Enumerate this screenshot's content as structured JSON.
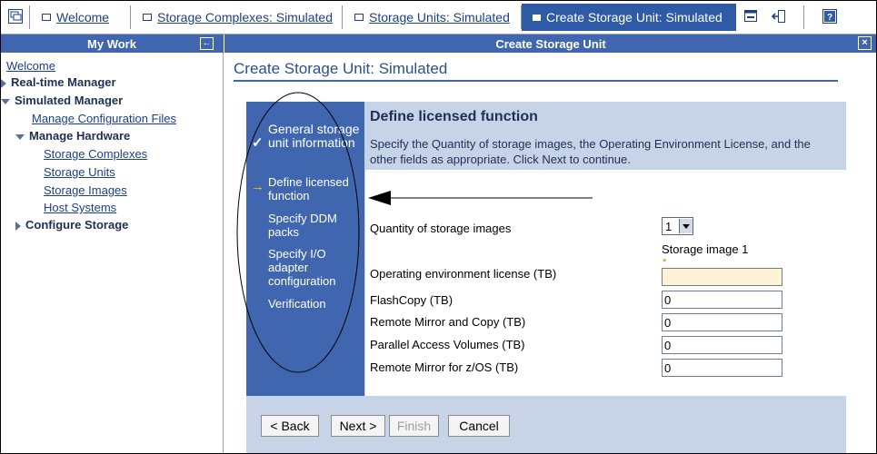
{
  "tabs": [
    {
      "label": "Welcome"
    },
    {
      "label": "Storage Complexes: Simulated"
    },
    {
      "label": "Storage Units: Simulated"
    },
    {
      "label": "Create Storage Unit: Simulated",
      "active": true
    }
  ],
  "sidebar": {
    "header": "My Work",
    "items": [
      {
        "label": "Welcome"
      },
      {
        "label": "Real-time Manager"
      },
      {
        "label": "Simulated Manager"
      },
      {
        "label": "Manage Configuration Files"
      },
      {
        "label": "Manage Hardware"
      },
      {
        "label": "Storage Complexes"
      },
      {
        "label": "Storage Units"
      },
      {
        "label": "Storage Images"
      },
      {
        "label": "Host Systems"
      },
      {
        "label": "Configure Storage"
      }
    ]
  },
  "main": {
    "header": "Create Storage Unit",
    "page_title": "Create Storage Unit: Simulated"
  },
  "wizard": {
    "steps": [
      {
        "label": "General storage unit information",
        "state": "done"
      },
      {
        "label": "Define licensed function",
        "state": "current"
      },
      {
        "label": "Specify DDM packs",
        "state": "pending"
      },
      {
        "label": "Specify I/O adapter configuration",
        "state": "pending"
      },
      {
        "label": "Verification",
        "state": "pending"
      }
    ],
    "content_title": "Define licensed function",
    "content_description": "Specify the Quantity of storage images, the Operating Environment License, and the other fields as appropriate. Click Next to continue.",
    "quantity_label": "Quantity of storage images",
    "quantity_value": "1",
    "storage_image_label": "Storage image 1",
    "required_marker": "*",
    "fields": [
      {
        "label": "Operating environment license (TB)",
        "value": ""
      },
      {
        "label": "FlashCopy (TB)",
        "value": "0"
      },
      {
        "label": "Remote Mirror and Copy (TB)",
        "value": "0"
      },
      {
        "label": "Parallel Access Volumes (TB)",
        "value": "0"
      },
      {
        "label": "Remote Mirror for z/OS (TB)",
        "value": "0"
      }
    ],
    "buttons": {
      "back": "< Back",
      "next": "Next >",
      "finish": "Finish",
      "cancel": "Cancel"
    }
  },
  "colors": {
    "accent": "#3f66ae",
    "panel": "#c7d3e6",
    "required_field": "#fff3d6"
  }
}
